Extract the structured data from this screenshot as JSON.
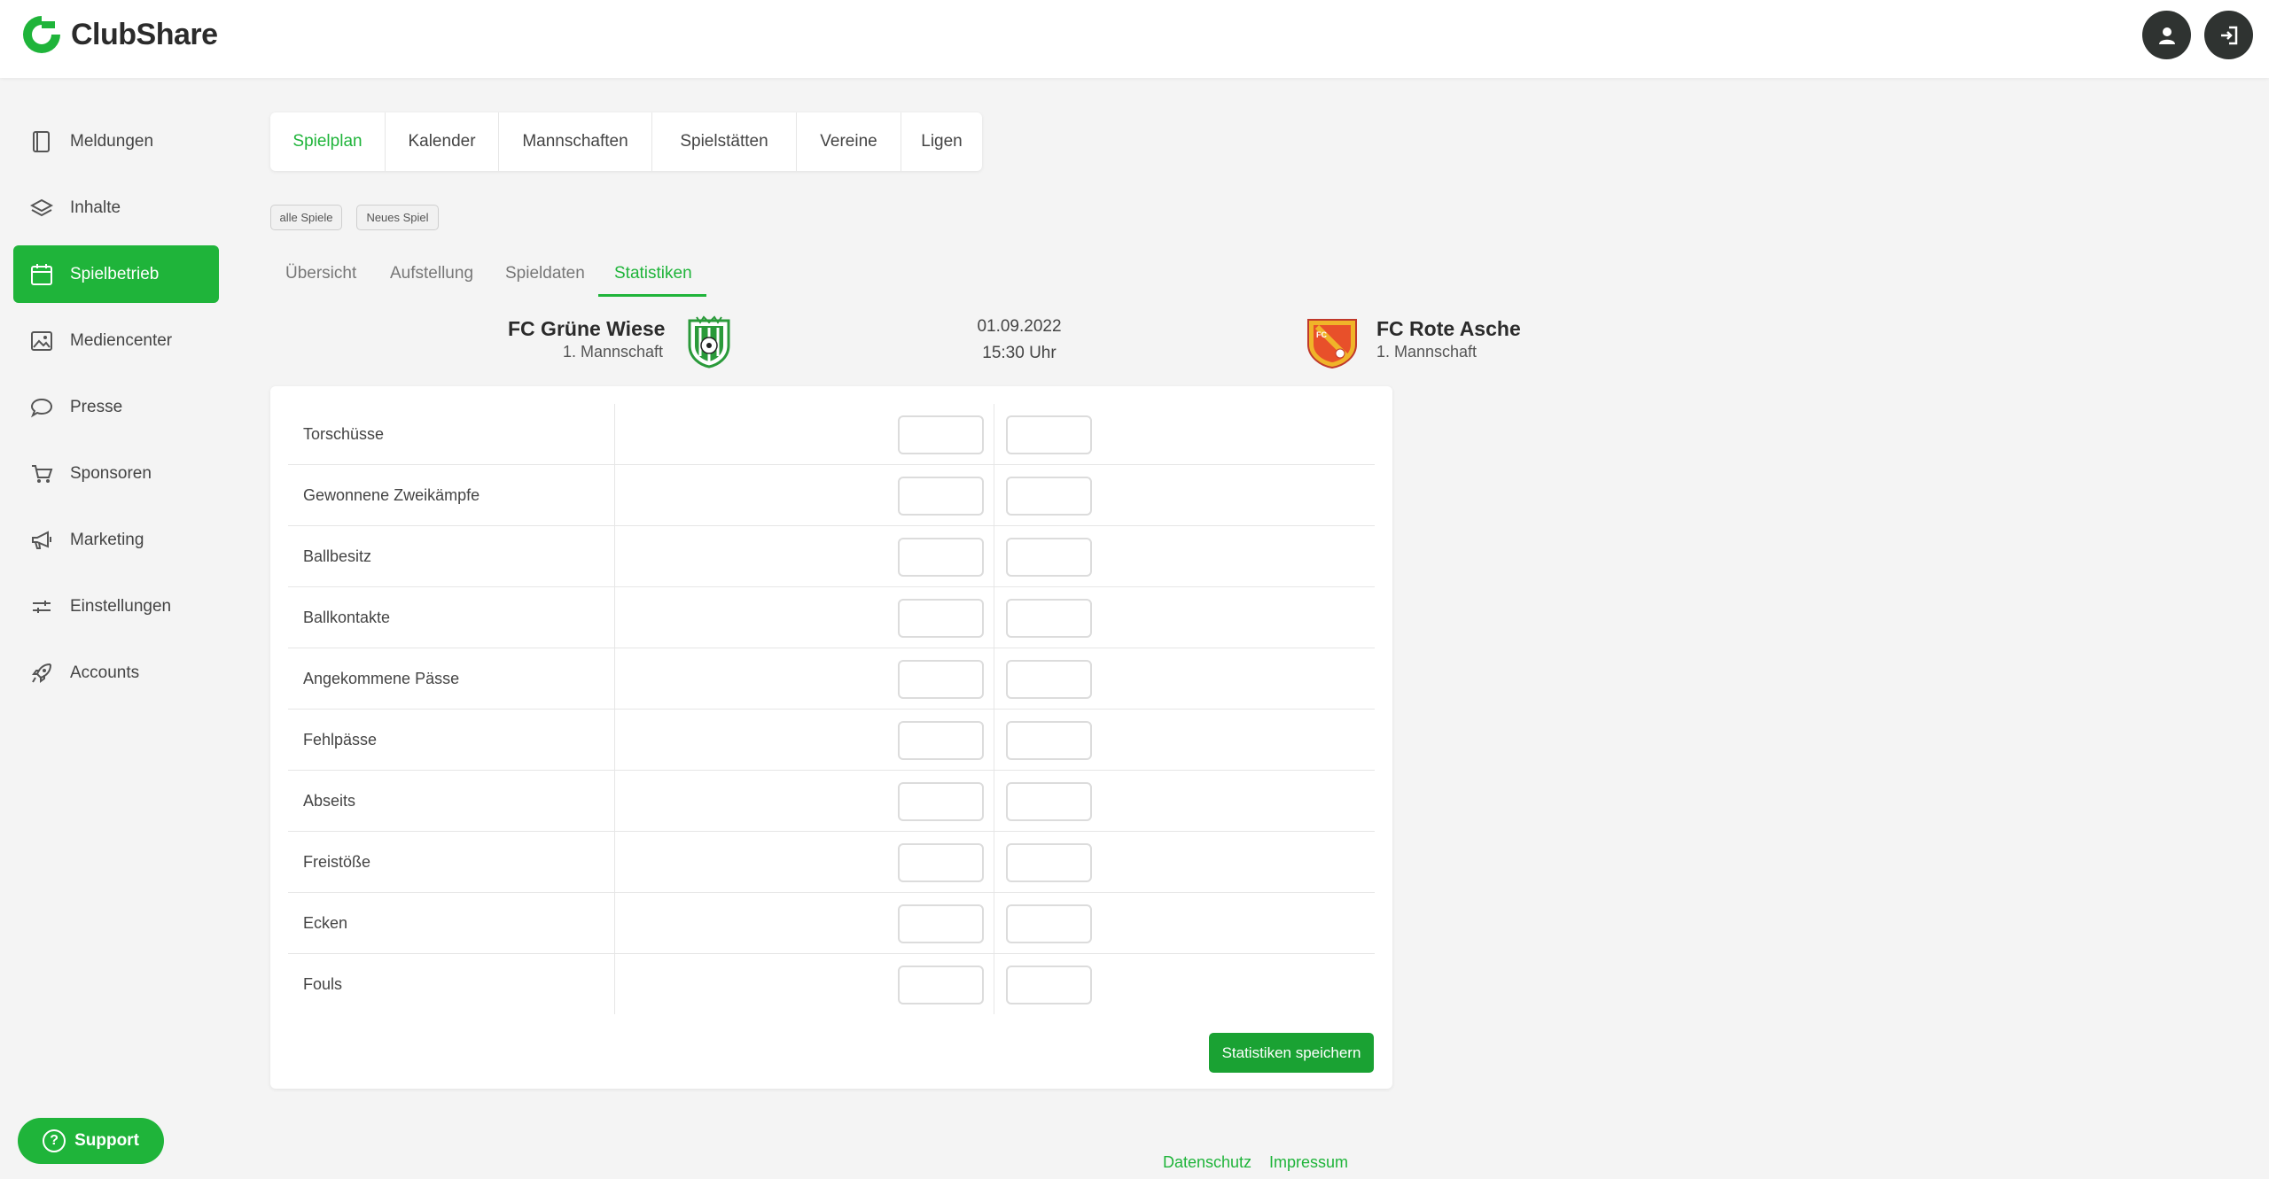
{
  "app": {
    "name": "ClubShare"
  },
  "colors": {
    "accent": "#1fb43a",
    "accent_dark": "#1aa233",
    "header_button": "#2f3331"
  },
  "header": {
    "user_icon": "user-icon",
    "logout_icon": "logout-icon"
  },
  "sidebar": {
    "items": [
      {
        "label": "Meldungen",
        "icon": "book-icon"
      },
      {
        "label": "Inhalte",
        "icon": "layers-icon"
      },
      {
        "label": "Spielbetrieb",
        "icon": "calendar-icon",
        "active": true
      },
      {
        "label": "Mediencenter",
        "icon": "image-icon"
      },
      {
        "label": "Presse",
        "icon": "speech-bubble-icon"
      },
      {
        "label": "Sponsoren",
        "icon": "cart-icon"
      },
      {
        "label": "Marketing",
        "icon": "megaphone-icon"
      },
      {
        "label": "Einstellungen",
        "icon": "sliders-icon"
      },
      {
        "label": "Accounts",
        "icon": "rocket-icon"
      }
    ],
    "support_label": "Support"
  },
  "top_tabs": [
    {
      "label": "Spielplan",
      "active": true
    },
    {
      "label": "Kalender"
    },
    {
      "label": "Mannschaften"
    },
    {
      "label": "Spielstätten"
    },
    {
      "label": "Vereine"
    },
    {
      "label": "Ligen"
    }
  ],
  "actions": {
    "all_games": "alle Spiele",
    "new_game": "Neues Spiel"
  },
  "sub_tabs": [
    {
      "label": "Übersicht"
    },
    {
      "label": "Aufstellung"
    },
    {
      "label": "Spieldaten"
    },
    {
      "label": "Statistiken",
      "active": true
    }
  ],
  "match": {
    "home": {
      "name": "FC Grüne Wiese",
      "team": "1. Mannschaft",
      "crest_color": "#2a9a3a"
    },
    "away": {
      "name": "FC Rote Asche",
      "team": "1. Mannschaft",
      "crest_color": "#e8502a"
    },
    "date": "01.09.2022",
    "time": "15:30 Uhr"
  },
  "stats": {
    "rows": [
      {
        "label": "Torschüsse",
        "home": "",
        "away": ""
      },
      {
        "label": "Gewonnene Zweikämpfe",
        "home": "",
        "away": ""
      },
      {
        "label": "Ballbesitz",
        "home": "",
        "away": ""
      },
      {
        "label": "Ballkontakte",
        "home": "",
        "away": ""
      },
      {
        "label": "Angekommene Pässe",
        "home": "",
        "away": ""
      },
      {
        "label": "Fehlpässe",
        "home": "",
        "away": ""
      },
      {
        "label": "Abseits",
        "home": "",
        "away": ""
      },
      {
        "label": "Freistöße",
        "home": "",
        "away": ""
      },
      {
        "label": "Ecken",
        "home": "",
        "away": ""
      },
      {
        "label": "Fouls",
        "home": "",
        "away": ""
      }
    ],
    "save_label": "Statistiken speichern"
  },
  "footer": {
    "privacy": "Datenschutz",
    "imprint": "Impressum"
  }
}
